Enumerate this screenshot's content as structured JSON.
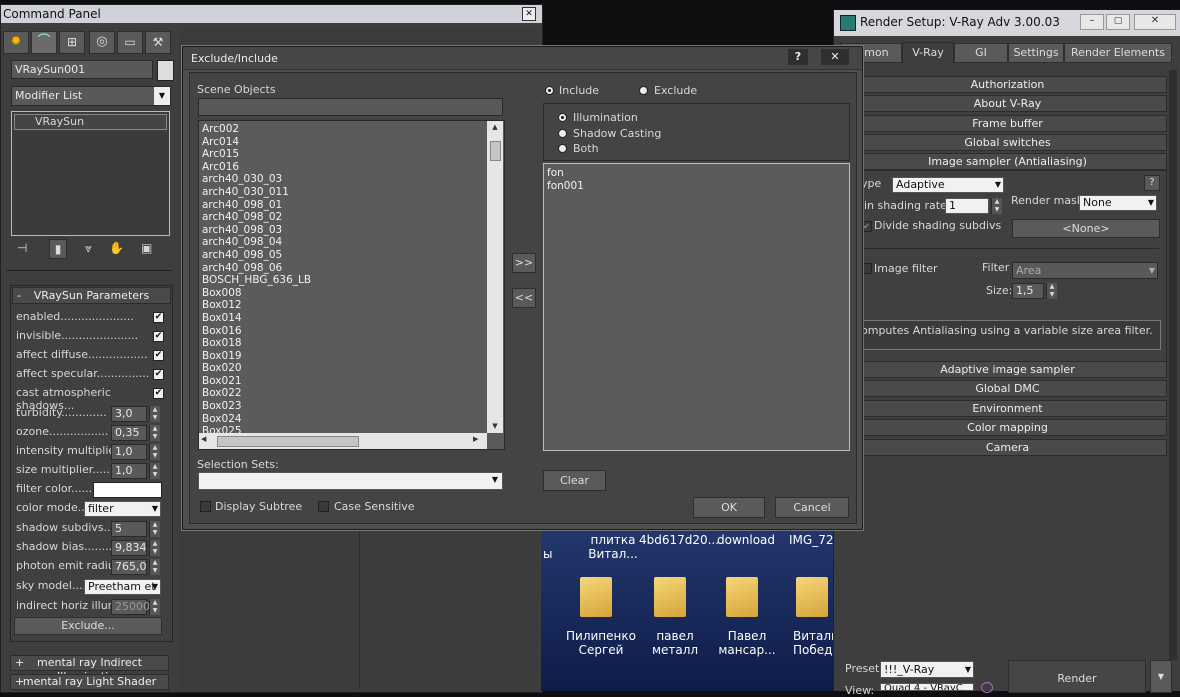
{
  "command_panel": {
    "title": "Command Panel",
    "object_name": "VRaySun001",
    "modifier_list": "Modifier List",
    "stack_item": "VRaySun",
    "params_title": "VRaySun Parameters",
    "collapse_sign": "-",
    "params": [
      {
        "label": "enabled.....................",
        "check": "✔"
      },
      {
        "label": "invisible......................",
        "check": "✔"
      },
      {
        "label": "affect diffuse.................",
        "check": "✔"
      },
      {
        "label": "affect specular...............",
        "check": "✔"
      },
      {
        "label": "cast atmospheric shadows...",
        "check": "✔"
      }
    ],
    "spinners": [
      {
        "label": "turbidity.............",
        "value": "3,0"
      },
      {
        "label": "ozone.................",
        "value": "0,35"
      },
      {
        "label": "intensity multiplier..",
        "value": "1,0"
      },
      {
        "label": "size multiplier.......",
        "value": "1,0"
      },
      {
        "label": "shadow subdivs.......",
        "value": "5"
      },
      {
        "label": "shadow bias.........",
        "value": "9,834"
      },
      {
        "label": "photon emit radius.",
        "value": "765,0"
      },
      {
        "label": "indirect horiz illum..",
        "value": "25000,"
      }
    ],
    "filter_color_label": "filter color.......",
    "color_mode_label": "color mode....",
    "color_mode_value": "filter",
    "sky_model_label": "sky model......",
    "sky_model_value": "Preetham et",
    "exclude_button": "Exclude...",
    "rollout_1": "mental ray Indirect Illumination",
    "rollout_2": "mental ray Light Shader",
    "rollout_sign": "+"
  },
  "dialog": {
    "title": "Exclude/Include",
    "help": "?",
    "close": "✕",
    "scene_objects_label": "Scene Objects",
    "scene_objects": [
      "Arc002",
      "Arc014",
      "Arc015",
      "Arc016",
      "arch40_030_03",
      "arch40_030_011",
      "arch40_098_01",
      "arch40_098_02",
      "arch40_098_03",
      "arch40_098_04",
      "arch40_098_05",
      "arch40_098_06",
      "BOSCH_HBG_636_LB",
      "Box008",
      "Box012",
      "Box014",
      "Box016",
      "Box018",
      "Box019",
      "Box020",
      "Box021",
      "Box022",
      "Box023",
      "Box024",
      "Box025"
    ],
    "include_label": "Include",
    "exclude_label": "Exclude",
    "illumination_label": "Illumination",
    "shadow_casting_label": "Shadow Casting",
    "both_label": "Both",
    "included_objects": [
      "fon",
      "fon001"
    ],
    "move_right": ">>",
    "move_left": "<<",
    "selection_sets_label": "Selection Sets:",
    "display_subtree_label": "Display Subtree",
    "case_sensitive_label": "Case Sensitive",
    "clear_button": "Clear",
    "ok_button": "OK",
    "cancel_button": "Cancel"
  },
  "render_setup": {
    "title": "Render Setup: V-Ray Adv 3.00.03",
    "tabs": [
      "mmon",
      "V-Ray",
      "GI",
      "Settings",
      "Render Elements"
    ],
    "rollouts_top": [
      "Authorization",
      "About V-Ray",
      "Frame buffer",
      "Global switches",
      "Image sampler (Antialiasing)"
    ],
    "type_label": "ype",
    "type_value": "Adaptive",
    "help": "?",
    "min_shading_label": "in shading rate",
    "min_shading_value": "1",
    "render_mask_label": "Render mask",
    "render_mask_value": "None",
    "divide_label": "Divide shading subdivs",
    "none_button": "<None>",
    "image_filter_label": "Image filter",
    "filter_label": "Filter",
    "filter_value": "Area",
    "size_label": "Size:",
    "size_value": "1,5",
    "filter_desc": "omputes Antialiasing using a variable size area filter.",
    "rollouts_bottom": [
      "Adaptive image sampler",
      "Global DMC",
      "Environment",
      "Color mapping",
      "Camera"
    ],
    "preset_label": "Preset:",
    "preset_value": "!!!_V-Ray",
    "view_label": "View:",
    "view_value": "Quad 4 - VRayC",
    "render_button": "Render"
  },
  "desktop": {
    "top_labels": [
      "ы",
      "плитка\nВитал...",
      "4bd617d20...",
      "download",
      "IMG_72"
    ],
    "folders": [
      {
        "label": "Пилипенко\nСергей"
      },
      {
        "label": "павел\nметалл"
      },
      {
        "label": "Павел\nмансар..."
      },
      {
        "label": "Витали\nПобед"
      }
    ]
  }
}
